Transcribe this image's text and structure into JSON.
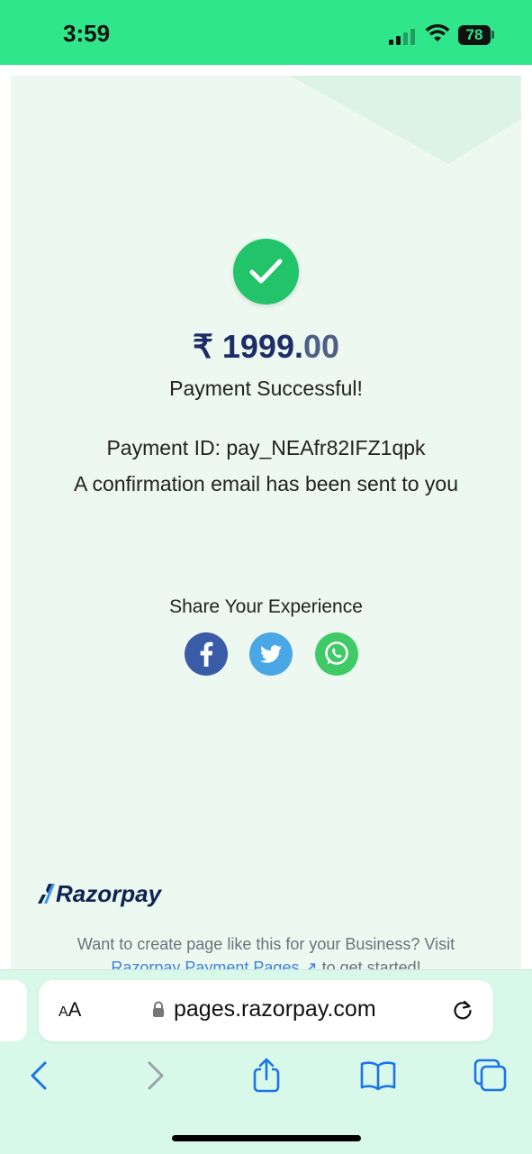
{
  "status_bar": {
    "time": "3:59",
    "battery": "78"
  },
  "payment": {
    "currency": "₹",
    "amount_main": "1999.",
    "amount_decimals": "00",
    "status": "Payment Successful!",
    "payment_id": "Payment ID: pay_NEAfr82IFZ1qpk",
    "confirmation": "A confirmation email has been sent to you"
  },
  "share": {
    "title": "Share Your Experience",
    "buttons": [
      "facebook-icon",
      "twitter-icon",
      "whatsapp-icon"
    ]
  },
  "footer": {
    "brand": "Razorpay",
    "promo_line1": "Want to create page like this for your Business? Visit",
    "promo_link": "Razorpay Payment Pages",
    "promo_suffix": " to get started!"
  },
  "browser": {
    "aa_label_small": "A",
    "aa_label_large": "A",
    "url": "pages.razorpay.com"
  },
  "colors": {
    "status_bar": "#2fe68a",
    "page_background": "#edf8f0",
    "success_green": "#21c469",
    "amount_color": "#1c2d68",
    "facebook": "#3a5ba8",
    "twitter": "#4aa7e6",
    "whatsapp": "#3fca67",
    "link": "#3b82e0"
  }
}
